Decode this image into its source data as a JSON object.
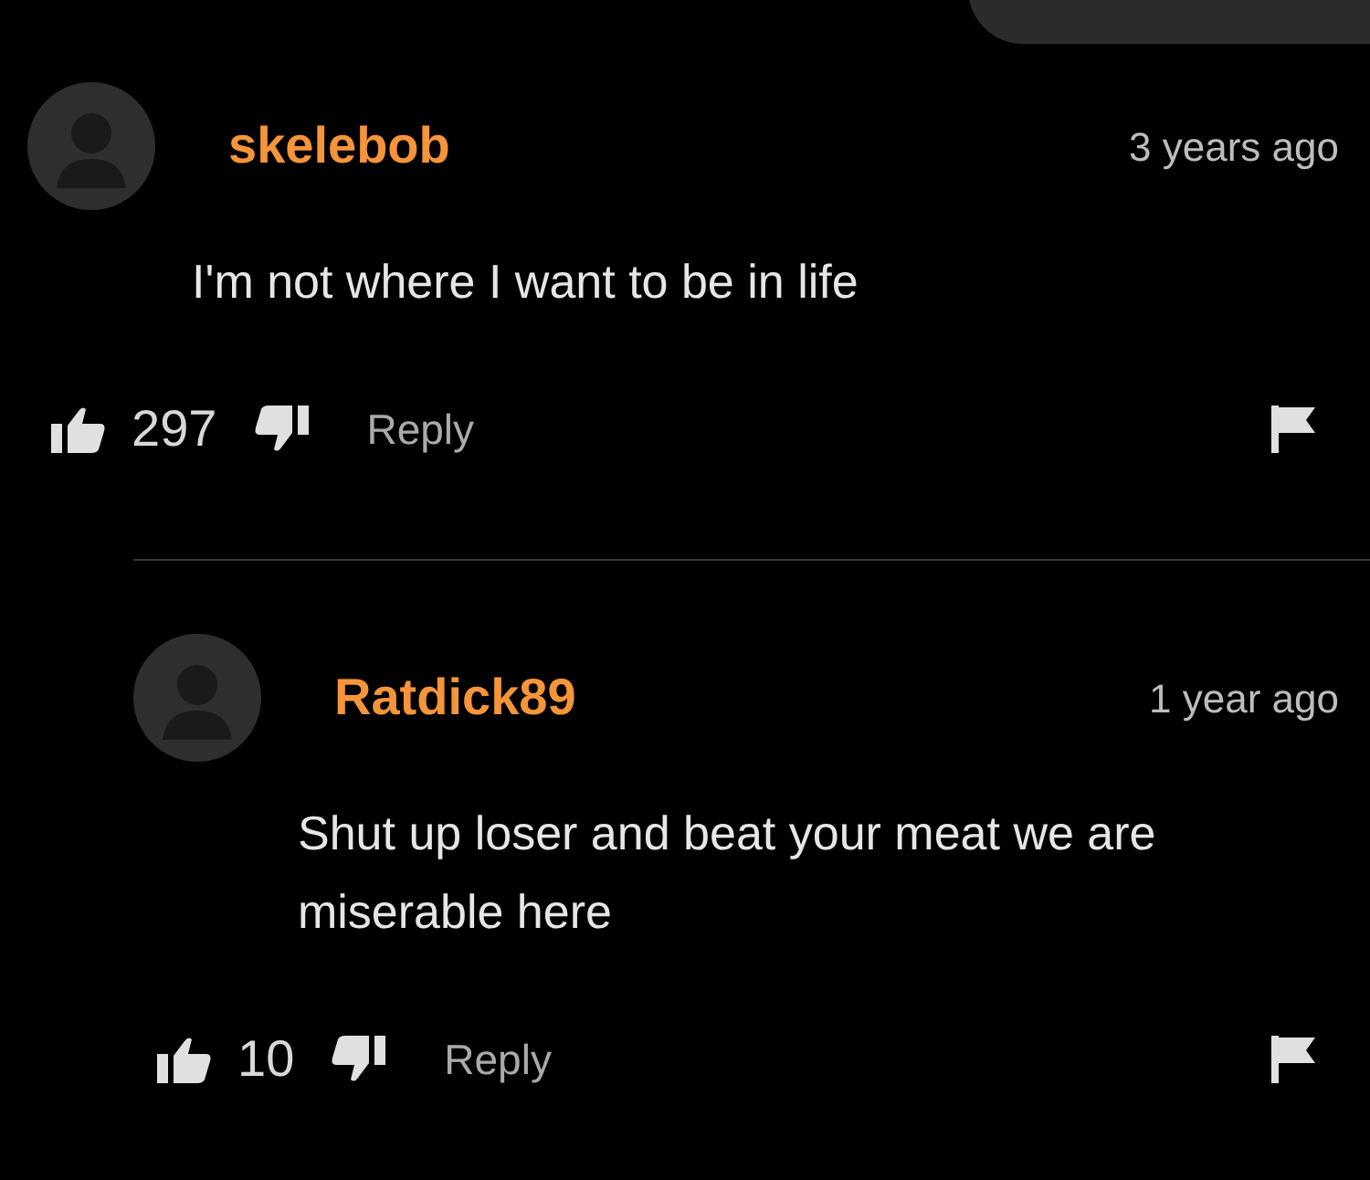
{
  "comments": [
    {
      "author": "skelebob",
      "time": "3 years ago",
      "text": "I'm not where I want to be in life",
      "likes": "297",
      "reply_label": "Reply",
      "nested": false
    },
    {
      "author": "Ratdick89",
      "time": "1 year ago",
      "text": "Shut up loser and beat your meat we are miserable here",
      "likes": "10",
      "reply_label": "Reply",
      "nested": true
    }
  ]
}
